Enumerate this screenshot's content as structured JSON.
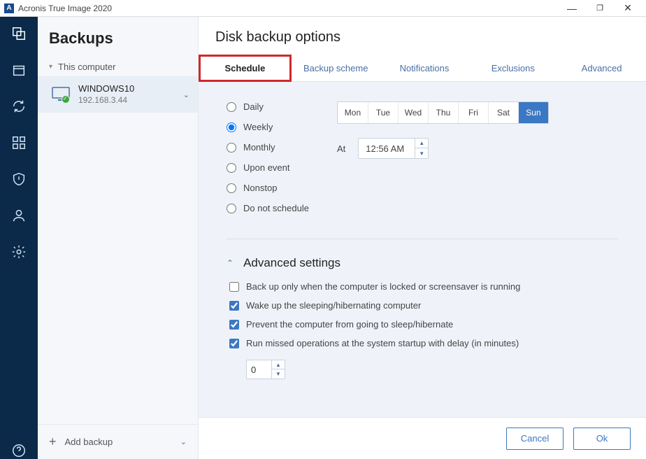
{
  "titlebar": {
    "title": "Acronis True Image 2020"
  },
  "sidebar": {
    "heading": "Backups",
    "group_label": "This computer",
    "item": {
      "name": "WINDOWS10",
      "subtitle": "192.168.3.44"
    },
    "add_backup": "Add backup"
  },
  "main": {
    "heading": "Disk backup options",
    "tabs": {
      "schedule": "Schedule",
      "scheme": "Backup scheme",
      "notifications": "Notifications",
      "exclusions": "Exclusions",
      "advanced": "Advanced"
    },
    "radios": {
      "daily": "Daily",
      "weekly": "Weekly",
      "monthly": "Monthly",
      "upon_event": "Upon event",
      "nonstop": "Nonstop",
      "no_schedule": "Do not schedule"
    },
    "days": {
      "mon": "Mon",
      "tue": "Tue",
      "wed": "Wed",
      "thu": "Thu",
      "fri": "Fri",
      "sat": "Sat",
      "sun": "Sun"
    },
    "at_label": "At",
    "time_value": "12:56 AM",
    "advanced_settings": {
      "heading": "Advanced settings",
      "backup_locked": "Back up only when the computer is locked or screensaver is running",
      "wake_up": "Wake up the sleeping/hibernating computer",
      "prevent_sleep": "Prevent the computer from going to sleep/hibernate",
      "run_missed": "Run missed operations at the system startup with delay (in minutes)",
      "delay_value": "0"
    },
    "footer": {
      "cancel": "Cancel",
      "ok": "Ok"
    }
  }
}
